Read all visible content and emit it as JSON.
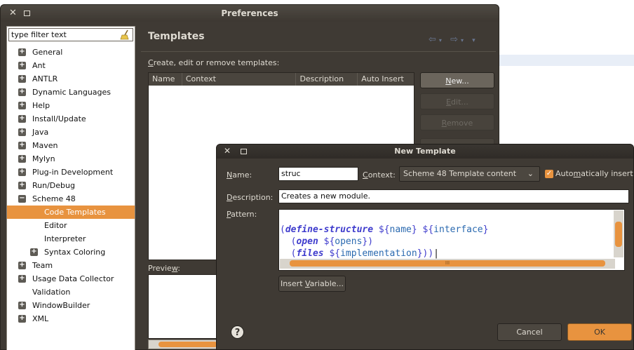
{
  "preferences": {
    "title": "Preferences",
    "filter_placeholder": "type filter text",
    "tree": [
      {
        "label": "General",
        "expandable": true,
        "level": 0
      },
      {
        "label": "Ant",
        "expandable": true,
        "level": 0
      },
      {
        "label": "ANTLR",
        "expandable": true,
        "level": 0
      },
      {
        "label": "Dynamic Languages",
        "expandable": true,
        "level": 0
      },
      {
        "label": "Help",
        "expandable": true,
        "level": 0
      },
      {
        "label": "Install/Update",
        "expandable": true,
        "level": 0
      },
      {
        "label": "Java",
        "expandable": true,
        "level": 0
      },
      {
        "label": "Maven",
        "expandable": true,
        "level": 0
      },
      {
        "label": "Mylyn",
        "expandable": true,
        "level": 0
      },
      {
        "label": "Plug-in Development",
        "expandable": true,
        "level": 0
      },
      {
        "label": "Run/Debug",
        "expandable": true,
        "level": 0
      },
      {
        "label": "Scheme 48",
        "expandable": true,
        "expanded": true,
        "level": 0
      },
      {
        "label": "Code Templates",
        "expandable": false,
        "level": 1,
        "selected": true
      },
      {
        "label": "Editor",
        "expandable": false,
        "level": 1
      },
      {
        "label": "Interpreter",
        "expandable": false,
        "level": 1
      },
      {
        "label": "Syntax Coloring",
        "expandable": true,
        "level": 1
      },
      {
        "label": "Team",
        "expandable": true,
        "level": 0
      },
      {
        "label": "Usage Data Collector",
        "expandable": true,
        "level": 0
      },
      {
        "label": "Validation",
        "expandable": false,
        "level": 0
      },
      {
        "label": "WindowBuilder",
        "expandable": true,
        "level": 0
      },
      {
        "label": "XML",
        "expandable": true,
        "level": 0
      }
    ],
    "page_title": "Templates",
    "description": "Create, edit or remove templates:",
    "columns": [
      "Name",
      "Context",
      "Description",
      "Auto Insert"
    ],
    "buttons": {
      "new": "New...",
      "edit": "Edit...",
      "remove": "Remove"
    },
    "preview_label": "Preview:"
  },
  "new_template": {
    "title": "New Template",
    "name_label": "Name:",
    "name_value": "struc",
    "context_label": "Context:",
    "context_value": "Scheme 48 Template content",
    "auto_insert_label": "Automatically insert",
    "description_label": "Description:",
    "description_value": "Creates a new module.",
    "pattern_label": "Pattern:",
    "pattern_lines": [
      "(define-structure ${name} ${interface}",
      "  (open ${opens})",
      "  (files ${implementation}))"
    ],
    "insert_variable": "Insert Variable...",
    "cancel": "Cancel",
    "ok": "OK"
  },
  "colors": {
    "accent": "#e8933f",
    "window": "#3f3a34",
    "keyword": "#3f3ccd"
  }
}
